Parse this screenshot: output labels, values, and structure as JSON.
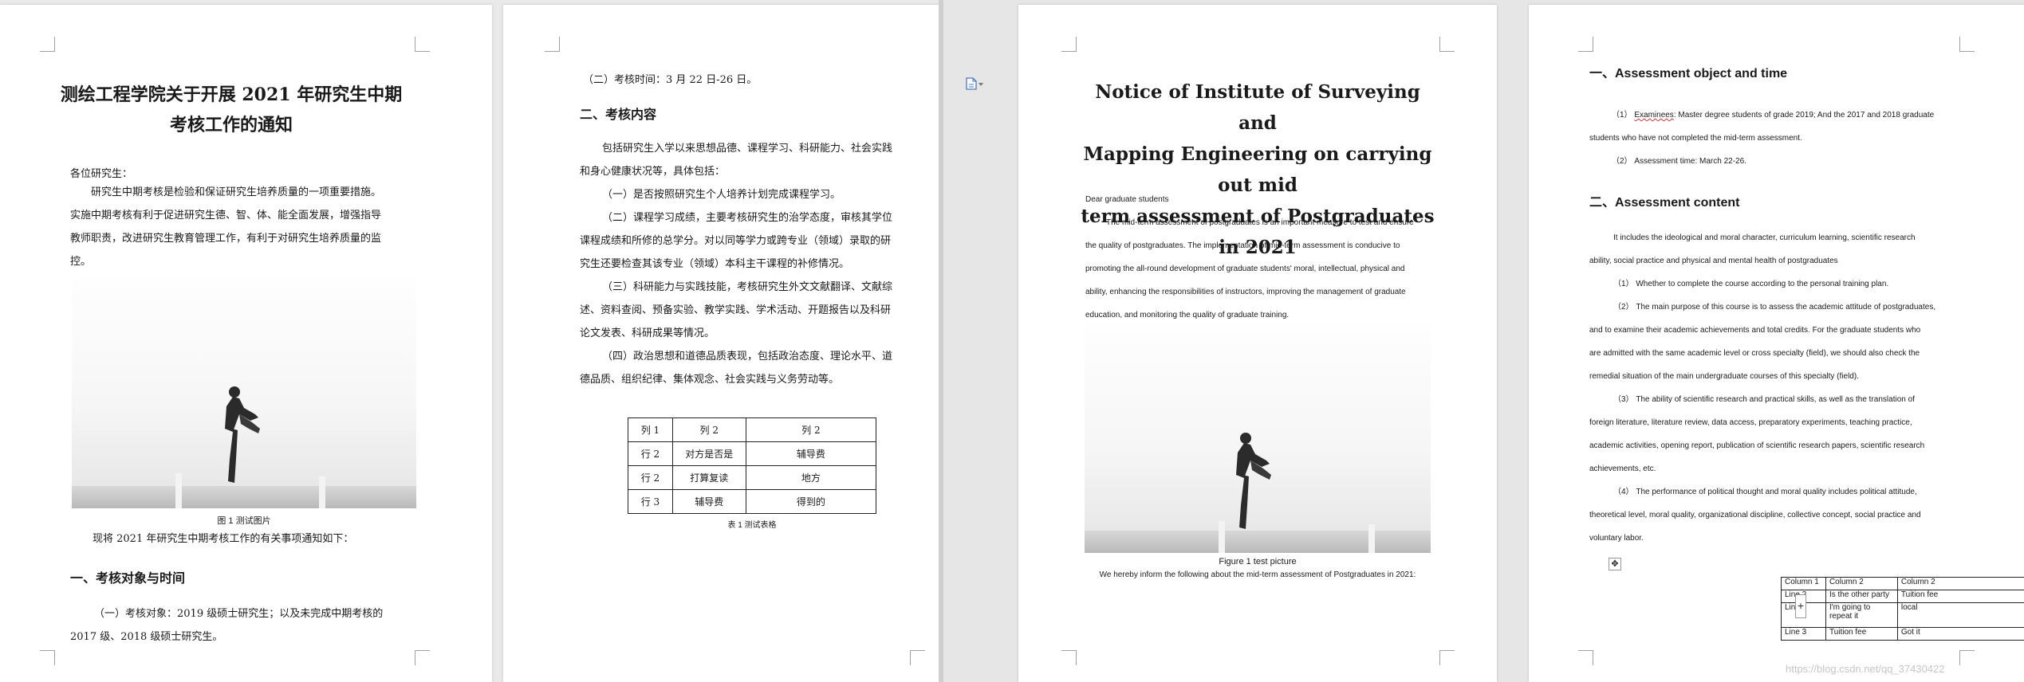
{
  "left_doc": {
    "page1": {
      "title_line1": "测绘工程学院关于开展 2021 年研究生中期",
      "title_line2": "考核工作的通知",
      "salutation": "各位研究生：",
      "intro_lines": [
        "研究生中期考核是检验和保证研究生培养质量的一项重要措施。",
        "实施中期考核有利于促进研究生德、智、体、能全面发展，增强指导",
        "教师职责，改进研究生教育管理工作，有利于对研究生培养质量的监",
        "控。"
      ],
      "figure_caption": "图 1 测试图片",
      "notice_line": "现将 2021 年研究生中期考核工作的有关事项通知如下：",
      "section1_heading": "一、考核对象与时间",
      "item1_lines": [
        "（一）考核对象：2019 级硕士研究生；以及未完成中期考核的",
        "2017 级、2018 级硕士研究生。"
      ]
    },
    "page2": {
      "item2_line": "（二）考核时间：3 月 22 日-26 日。",
      "section2_heading": "二、考核内容",
      "content_lines": [
        "包括研究生入学以来思想品德、课程学习、科研能力、社会实践",
        "和身心健康状况等，具体包括：",
        "（一）是否按照研究生个人培养计划完成课程学习。",
        "（二）课程学习成绩，主要考核研究生的治学态度，审核其学位",
        "课程成绩和所修的总学分。对以同等学力或跨专业（领域）录取的研",
        "究生还要检查其该专业（领域）本科主干课程的补修情况。",
        "（三）科研能力与实践技能，考核研究生外文文献翻译、文献综",
        "述、资料查阅、预备实验、教学实践、学术活动、开题报告以及科研",
        "论文发表、科研成果等情况。",
        "（四）政治思想和道德品质表现，包括政治态度、理论水平、道",
        "德品质、组织纪律、集体观念、社会实践与义务劳动等。"
      ],
      "table": [
        [
          "列 1",
          "列 2",
          "列 2"
        ],
        [
          "行 2",
          "对方是否是",
          "辅导费"
        ],
        [
          "行 2",
          "打算复读",
          "地方"
        ],
        [
          "行 3",
          "辅导费",
          "得到的"
        ]
      ],
      "table_caption": "表 1 测试表格"
    }
  },
  "right_doc": {
    "page1": {
      "title_lines": [
        "Notice of Institute of Surveying and",
        "Mapping Engineering on carrying out mid",
        "term assessment of Postgraduates in 2021"
      ],
      "salutation": "Dear graduate students",
      "body_lines": [
        "The mid-term assessment of postgraduates is an important measure to test and ensure",
        "the quality of postgraduates. The implementation of mid-term assessment is conducive to",
        "promoting the all-round development of graduate students' moral, intellectual, physical and",
        "ability, enhancing the responsibilities of instructors, improving the management of graduate",
        "education, and monitoring the quality of graduate training."
      ],
      "figure_caption": "Figure 1 test picture",
      "after_figure": "We hereby inform the following about the mid-term assessment of Postgraduates in 2021:"
    },
    "page2": {
      "section1_heading": "一、Assessment object and time",
      "item1_prefix": "（1）",
      "item1_flagged_word": "Examinees",
      "item1_rest": ": Master degree students of grade 2019; And the 2017 and 2018 graduate",
      "item1_line2": "students who have not completed the mid-term assessment.",
      "item2": "（2）  Assessment time: March 22-26.",
      "section2_heading": "二、Assessment content",
      "content_lines": [
        "It includes the ideological and moral character, curriculum learning, scientific research",
        "ability, social practice and physical and mental health of postgraduates",
        "（1）  Whether to complete the course according to the personal training plan.",
        "（2）  The main purpose of this course is to assess the academic attitude of postgraduates,",
        "and to examine their academic achievements and total credits. For the graduate students who",
        "are admitted with the same academic level or cross specialty (field), we should also check the",
        "remedial situation of the main undergraduate courses of this specialty (field).",
        "（3）  The ability of scientific research and practical skills, as well as the translation of",
        "foreign literature, literature review, data access, preparatory experiments, teaching practice,",
        "academic activities, opening report, publication of scientific research papers, scientific research",
        "achievements, etc.",
        "（4）  The performance of political thought and moral quality includes political attitude,",
        "theoretical level, moral quality, organizational discipline, collective concept, social practice and",
        "voluntary labor."
      ],
      "table": [
        [
          "Column 1",
          "Column 2",
          "Column 2"
        ],
        [
          "Line 2",
          "Is the other party",
          "Tuition fee"
        ],
        [
          "Line 2",
          "I'm  going  to repeat it",
          "local"
        ],
        [
          "Line 3",
          "Tuition fee",
          "Got it"
        ]
      ],
      "table_add_symbol": "+",
      "table_move_symbol": "✥"
    }
  },
  "watermark": "https://blog.csdn.net/qq_37430422",
  "colors": {
    "pane_background": "#e9e9e9",
    "page": "#ffffff",
    "spellcheck": "#dd3333",
    "doc_icon": "#4a78c2"
  }
}
